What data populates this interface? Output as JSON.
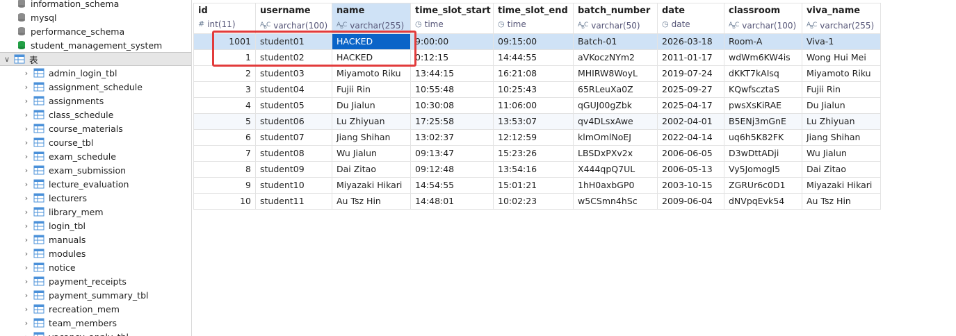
{
  "sidebar": {
    "databases": [
      {
        "label": "information_schema"
      },
      {
        "label": "mysql"
      },
      {
        "label": "performance_schema"
      },
      {
        "label": "student_management_system"
      }
    ],
    "tables_folder": {
      "label": "表"
    },
    "tables": [
      {
        "label": "admin_login_tbl"
      },
      {
        "label": "assignment_schedule"
      },
      {
        "label": "assignments"
      },
      {
        "label": "class_schedule"
      },
      {
        "label": "course_materials"
      },
      {
        "label": "course_tbl"
      },
      {
        "label": "exam_schedule"
      },
      {
        "label": "exam_submission"
      },
      {
        "label": "lecture_evaluation"
      },
      {
        "label": "lecturers"
      },
      {
        "label": "library_mem"
      },
      {
        "label": "login_tbl"
      },
      {
        "label": "manuals"
      },
      {
        "label": "modules"
      },
      {
        "label": "notice"
      },
      {
        "label": "payment_receipts"
      },
      {
        "label": "payment_summary_tbl"
      },
      {
        "label": "recreation_mem"
      },
      {
        "label": "team_members"
      },
      {
        "label": "vacancy_apply_tbl"
      }
    ]
  },
  "grid": {
    "columns": [
      {
        "name": "id",
        "type": "int(11)",
        "icon": "hash-icon"
      },
      {
        "name": "username",
        "type": "varchar(100)",
        "icon": "abc-icon"
      },
      {
        "name": "name",
        "type": "varchar(255)",
        "icon": "abc-icon"
      },
      {
        "name": "time_slot_start",
        "type": "time",
        "icon": "clock-icon"
      },
      {
        "name": "time_slot_end",
        "type": "time",
        "icon": "clock-icon"
      },
      {
        "name": "batch_number",
        "type": "varchar(50)",
        "icon": "abc-icon"
      },
      {
        "name": "date",
        "type": "date",
        "icon": "calendar-icon"
      },
      {
        "name": "classroom",
        "type": "varchar(100)",
        "icon": "abc-icon"
      },
      {
        "name": "viva_name",
        "type": "varchar(255)",
        "icon": "abc-icon"
      }
    ],
    "rows": [
      {
        "id": "1001",
        "username": "student01",
        "name": "HACKED",
        "start": "9:00:00",
        "end": "09:15:00",
        "batch": "Batch-01",
        "date": "2026-03-18",
        "classroom": "Room-A",
        "viva": "Viva-1"
      },
      {
        "id": "1",
        "username": "student02",
        "name": "HACKED",
        "start": "0:12:15",
        "end": "14:44:55",
        "batch": "aVKoczNYm2",
        "date": "2011-01-17",
        "classroom": "wdWm6KW4is",
        "viva": "Wong Hui Mei"
      },
      {
        "id": "2",
        "username": "student03",
        "name": "Miyamoto Riku",
        "start": "13:44:15",
        "end": "16:21:08",
        "batch": "MHIRW8WoyL",
        "date": "2019-07-24",
        "classroom": "dKKT7kAIsq",
        "viva": "Miyamoto Riku"
      },
      {
        "id": "3",
        "username": "student04",
        "name": "Fujii Rin",
        "start": "10:55:48",
        "end": "10:25:43",
        "batch": "65RLeuXa0Z",
        "date": "2025-09-27",
        "classroom": "KQwfscztaS",
        "viva": "Fujii Rin"
      },
      {
        "id": "4",
        "username": "student05",
        "name": "Du Jialun",
        "start": "10:30:08",
        "end": "11:06:00",
        "batch": "qGUJ00gZbk",
        "date": "2025-04-17",
        "classroom": "pwsXsKiRAE",
        "viva": "Du Jialun"
      },
      {
        "id": "5",
        "username": "student06",
        "name": "Lu Zhiyuan",
        "start": "17:25:58",
        "end": "13:53:07",
        "batch": "qv4DLsxAwe",
        "date": "2002-04-01",
        "classroom": "B5ENj3mGnE",
        "viva": "Lu Zhiyuan"
      },
      {
        "id": "6",
        "username": "student07",
        "name": "Jiang Shihan",
        "start": "13:02:37",
        "end": "12:12:59",
        "batch": "klmOmlNoEJ",
        "date": "2022-04-14",
        "classroom": "uq6h5K82FK",
        "viva": "Jiang Shihan"
      },
      {
        "id": "7",
        "username": "student08",
        "name": "Wu Jialun",
        "start": "09:13:47",
        "end": "15:23:26",
        "batch": "LBSDxPXv2x",
        "date": "2006-06-05",
        "classroom": "D3wDttADji",
        "viva": "Wu Jialun"
      },
      {
        "id": "8",
        "username": "student09",
        "name": "Dai Zitao",
        "start": "09:12:48",
        "end": "13:54:16",
        "batch": "X444qpQ7UL",
        "date": "2006-05-13",
        "classroom": "Vy5Jomogl5",
        "viva": "Dai Zitao"
      },
      {
        "id": "9",
        "username": "student10",
        "name": "Miyazaki Hikari",
        "start": "14:54:55",
        "end": "15:01:21",
        "batch": "1hH0axbGP0",
        "date": "2003-10-15",
        "classroom": "ZGRUr6c0D1",
        "viva": "Miyazaki Hikari"
      },
      {
        "id": "10",
        "username": "student11",
        "name": "Au Tsz Hin",
        "start": "14:48:01",
        "end": "10:02:23",
        "batch": "w5CSmn4hSc",
        "date": "2009-06-04",
        "classroom": "dNVpqEvk54",
        "viva": "Au Tsz Hin"
      }
    ]
  },
  "colors": {
    "selection": "#cfe2f6",
    "active_cell": "#0a64c8",
    "highlight_box": "#e23b3b",
    "db_icon_default": "#8c8c8c",
    "db_icon_active": "#22a045",
    "table_icon": "#4a90d9"
  }
}
